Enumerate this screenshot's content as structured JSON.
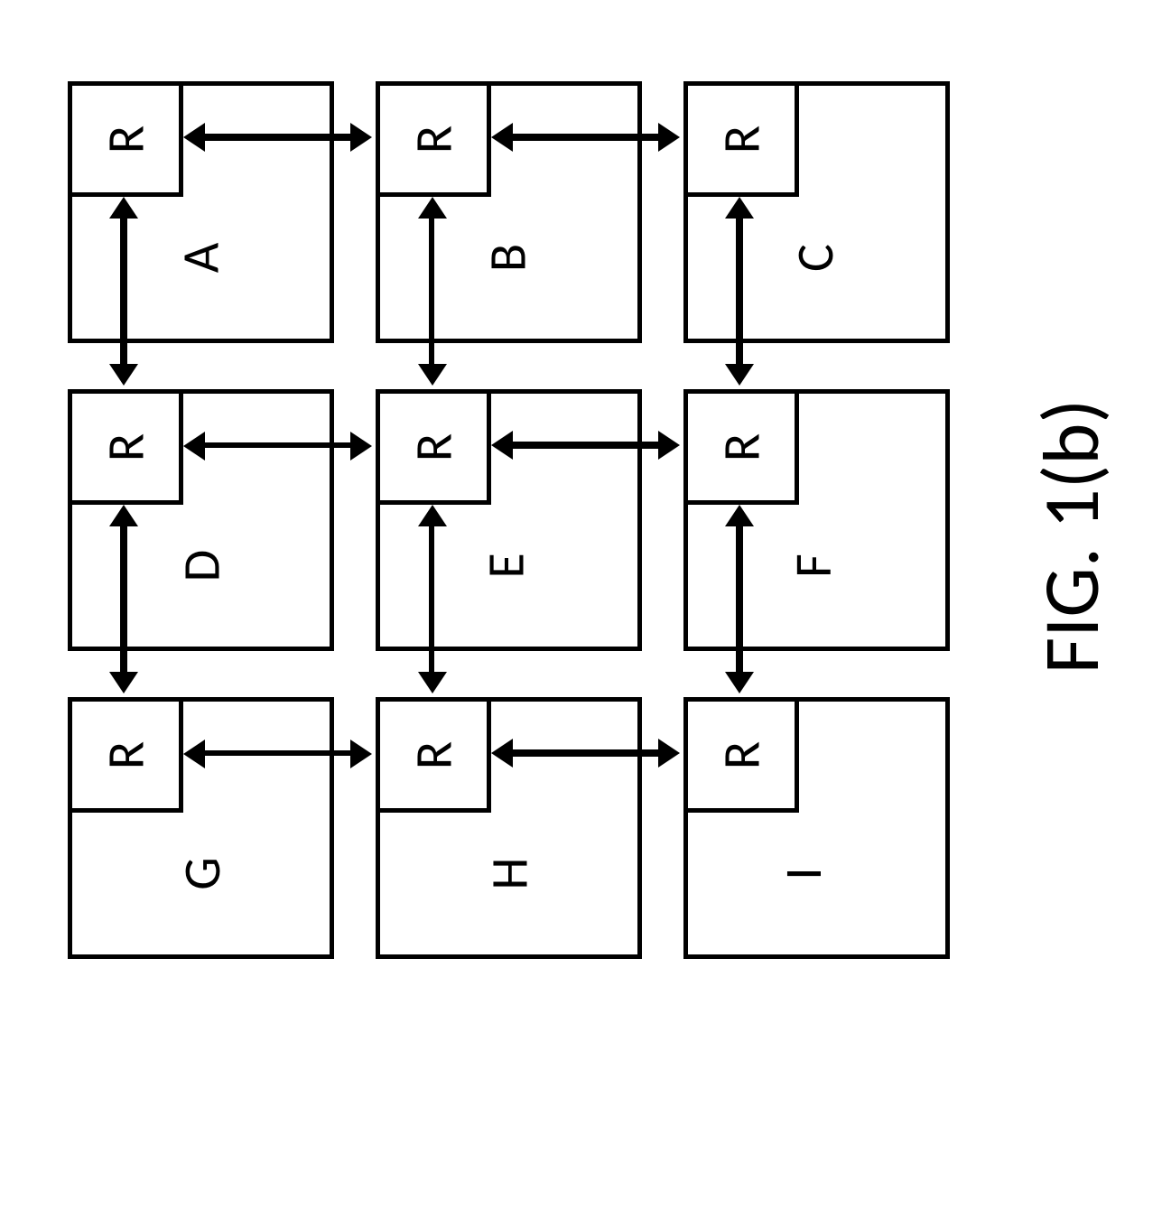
{
  "figure": {
    "caption": "FIG. 1(b)",
    "router_label": "R",
    "grid": {
      "rows": 3,
      "cols": 3
    },
    "tiles": [
      {
        "id": "A",
        "row": 0,
        "col": 0
      },
      {
        "id": "B",
        "row": 0,
        "col": 1
      },
      {
        "id": "C",
        "row": 0,
        "col": 2
      },
      {
        "id": "D",
        "row": 1,
        "col": 0
      },
      {
        "id": "E",
        "row": 1,
        "col": 1
      },
      {
        "id": "F",
        "row": 1,
        "col": 2
      },
      {
        "id": "G",
        "row": 2,
        "col": 0
      },
      {
        "id": "H",
        "row": 2,
        "col": 1
      },
      {
        "id": "I",
        "row": 2,
        "col": 2
      }
    ],
    "links": [
      {
        "from": "A",
        "to": "B",
        "dir": "h",
        "weight": "heavy"
      },
      {
        "from": "B",
        "to": "C",
        "dir": "h",
        "weight": "heavy"
      },
      {
        "from": "D",
        "to": "E",
        "dir": "h",
        "weight": "light"
      },
      {
        "from": "E",
        "to": "F",
        "dir": "h",
        "weight": "heavy"
      },
      {
        "from": "G",
        "to": "H",
        "dir": "h",
        "weight": "light"
      },
      {
        "from": "H",
        "to": "I",
        "dir": "h",
        "weight": "heavy"
      },
      {
        "from": "A",
        "to": "D",
        "dir": "v",
        "weight": "heavy"
      },
      {
        "from": "D",
        "to": "G",
        "dir": "v",
        "weight": "heavy"
      },
      {
        "from": "B",
        "to": "E",
        "dir": "v",
        "weight": "light"
      },
      {
        "from": "E",
        "to": "H",
        "dir": "v",
        "weight": "light"
      },
      {
        "from": "C",
        "to": "F",
        "dir": "v",
        "weight": "heavy"
      },
      {
        "from": "F",
        "to": "I",
        "dir": "v",
        "weight": "heavy"
      }
    ]
  }
}
